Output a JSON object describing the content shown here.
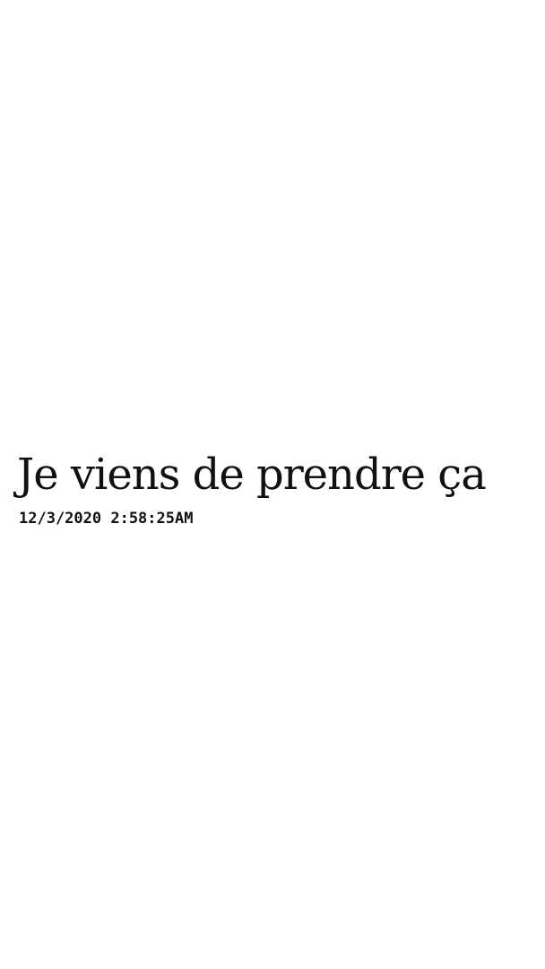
{
  "post": {
    "title": "Je viens de prendre ça",
    "timestamp": "12/3/2020 2:58:25AM"
  }
}
